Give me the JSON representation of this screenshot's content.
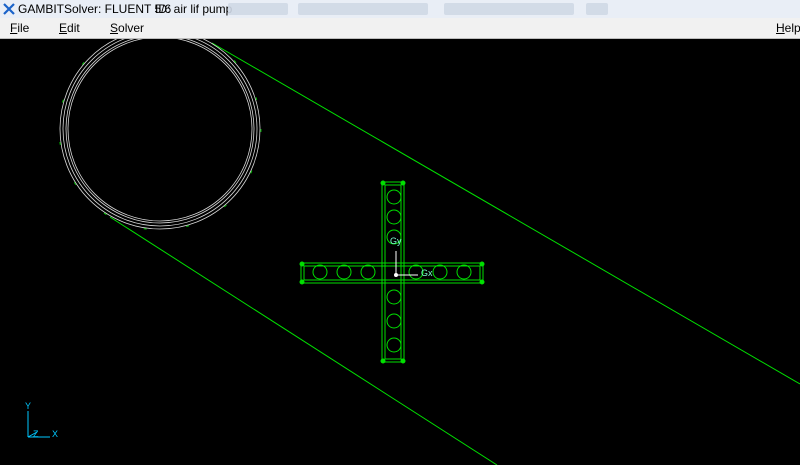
{
  "titlebar": {
    "app_name": "GAMBIT",
    "solver": "Solver: FLUENT 5/6",
    "model_id": "ID: air lif pump"
  },
  "menu": {
    "file": "File",
    "edit": "Edit",
    "solver": "Solver",
    "help": "Help"
  },
  "canvas": {
    "labels": {
      "gy": "Gy",
      "gx": "Gx"
    },
    "axis_triad": {
      "y": "Y",
      "z": "Z",
      "x": "X"
    },
    "colors": {
      "geometry": "#00e000",
      "circle_mesh": "#d8d8d8",
      "background": "#000000"
    }
  }
}
